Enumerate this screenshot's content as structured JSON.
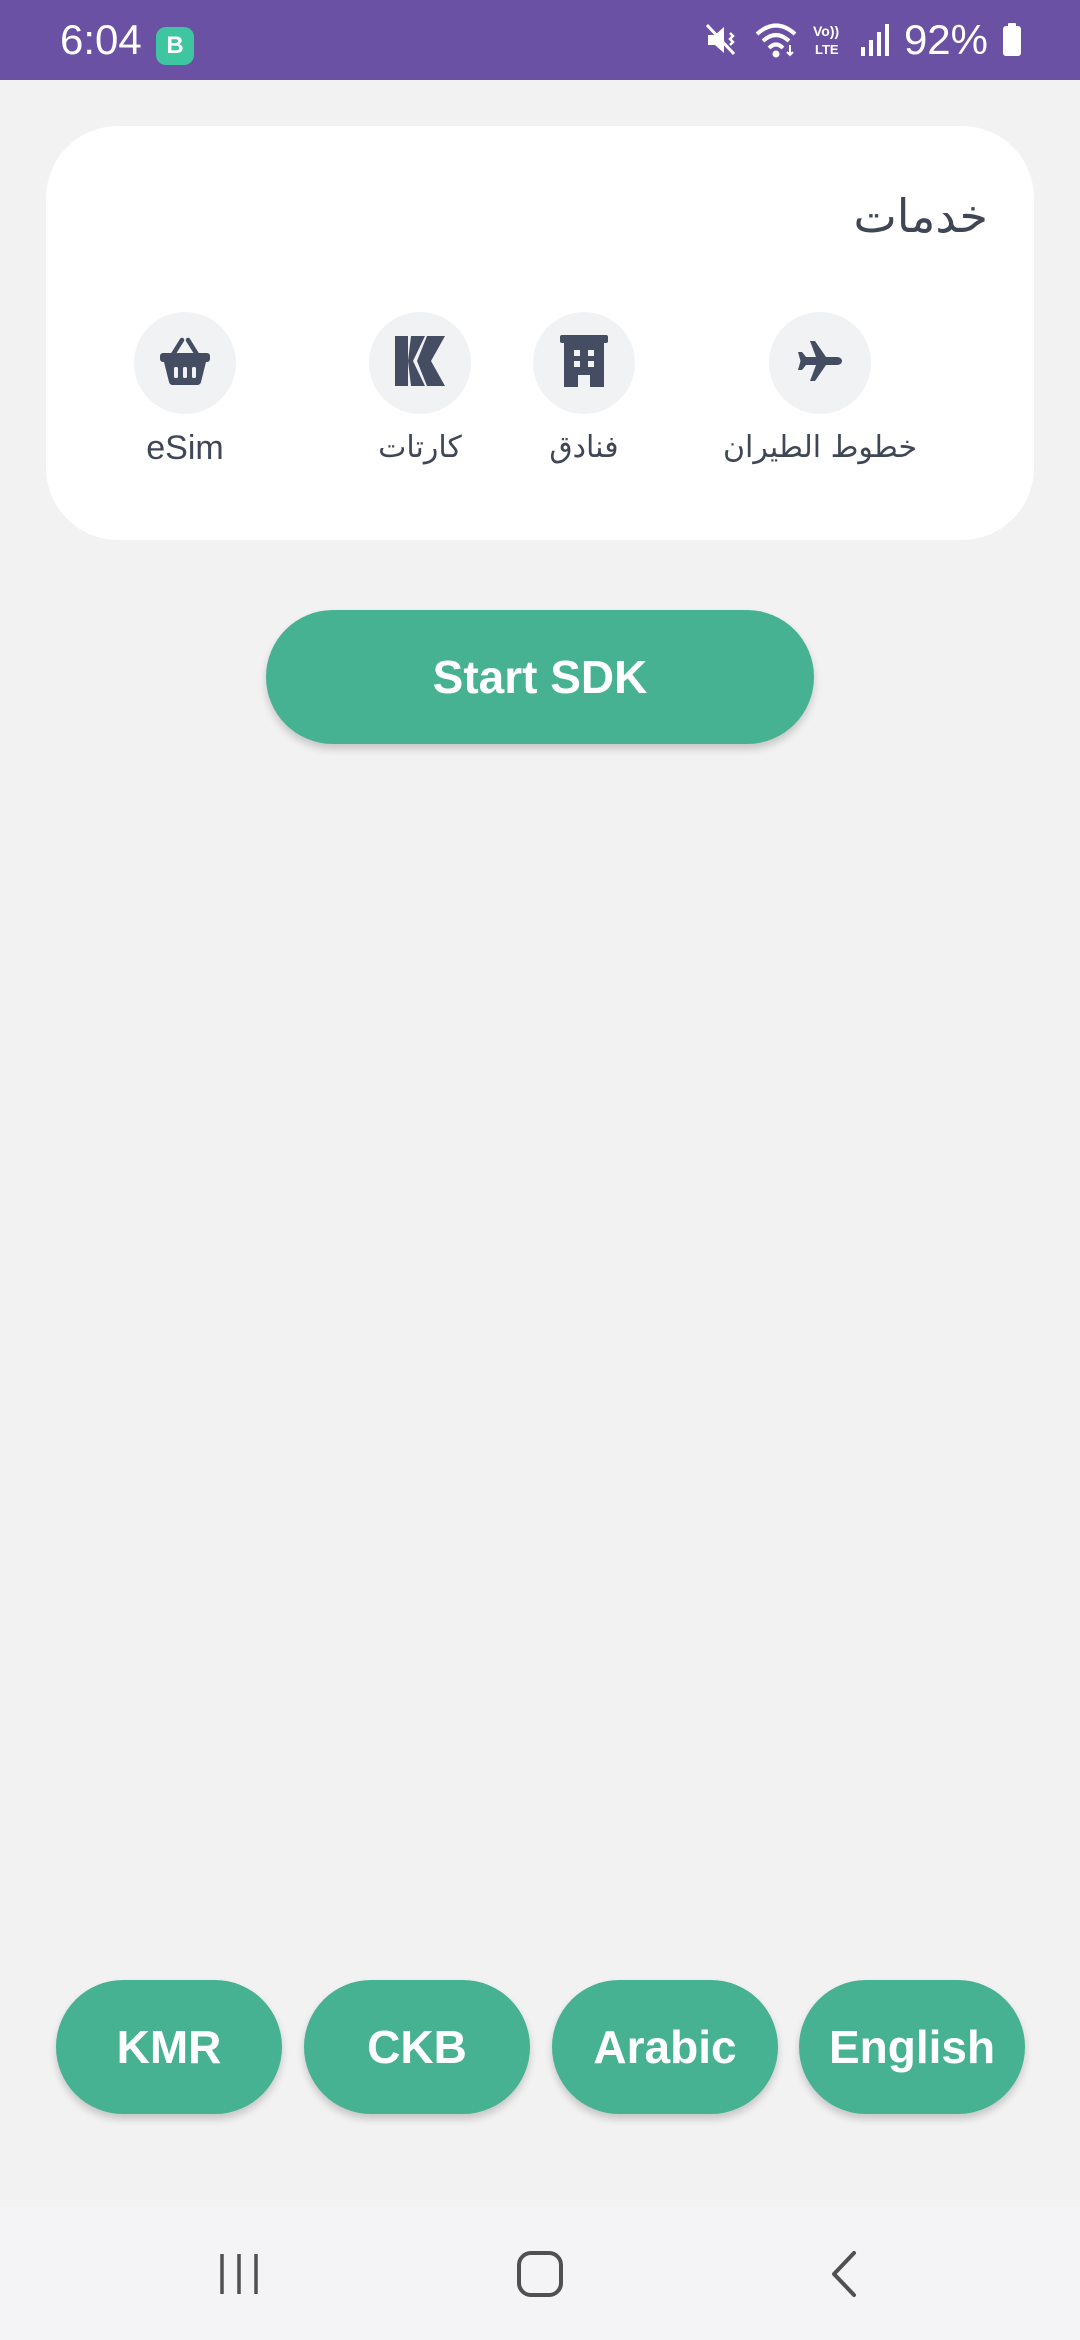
{
  "status_bar": {
    "time": "6:04",
    "battery": "92%",
    "background_color": "#6a51a4",
    "icons": [
      "app-notification-icon",
      "mute-vibrate-icon",
      "wifi-icon",
      "volte-icon",
      "signal-icon",
      "battery-icon"
    ]
  },
  "services": {
    "title": "خدمات",
    "items": [
      {
        "label": "خطوط الطيران",
        "icon": "airplane-icon"
      },
      {
        "label": "فنادق",
        "icon": "hotel-building-icon"
      },
      {
        "label": "كارتات",
        "icon": "card-k-logo-icon"
      },
      {
        "label": "eSim",
        "icon": "shopping-basket-icon"
      }
    ]
  },
  "actions": {
    "start_sdk": "Start SDK"
  },
  "languages": [
    "English",
    "Arabic",
    "CKB",
    "KMR"
  ],
  "navigation": {
    "icons": [
      "recent-apps-icon",
      "home-icon",
      "back-icon"
    ]
  },
  "colors": {
    "accent": "#47b291",
    "background": "#f2f2f2",
    "card": "#ffffff",
    "icon": "#454d63"
  }
}
